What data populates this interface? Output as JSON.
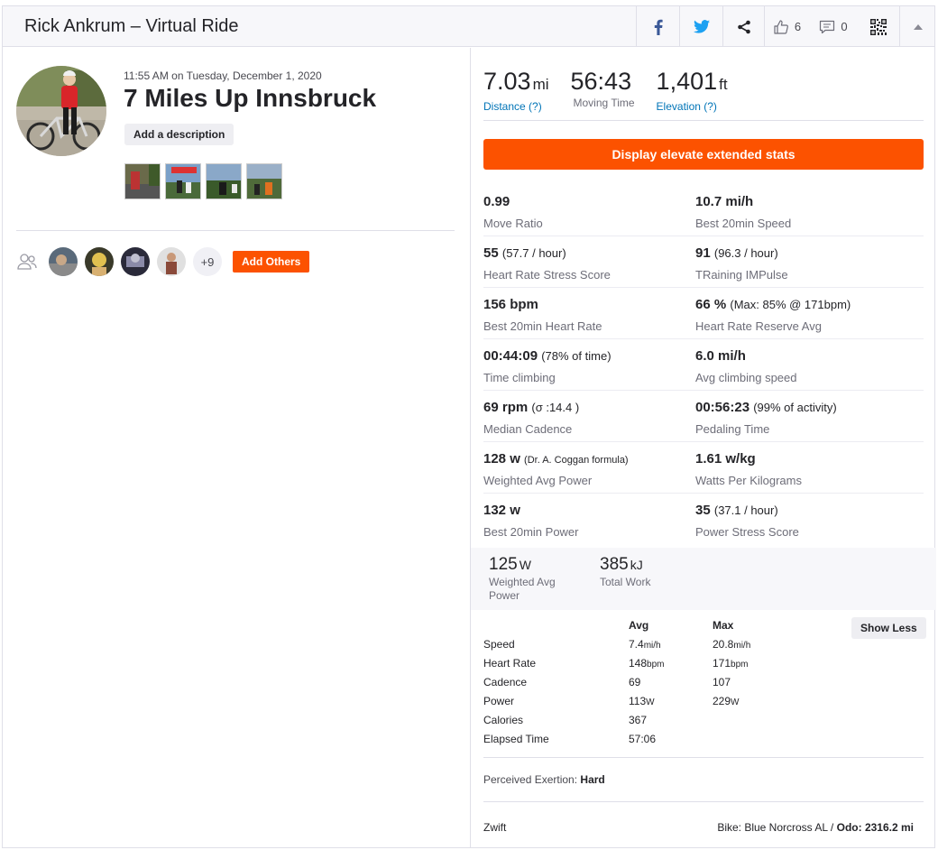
{
  "header": {
    "title": "Rick Ankrum – Virtual Ride",
    "kudos_count": "6",
    "comment_count": "0"
  },
  "activity": {
    "datetime": "11:55 AM on Tuesday, December 1, 2020",
    "name": "7 Miles Up Innsbruck",
    "add_description": "Add a description"
  },
  "group": {
    "more_count": "+9",
    "add_others": "Add Others"
  },
  "inline_stats": [
    {
      "value": "7.03",
      "unit": "mi",
      "label": "Distance (?)"
    },
    {
      "value": "56:43",
      "unit": "",
      "label": "Moving Time"
    },
    {
      "value": "1,401",
      "unit": "ft",
      "label": "Elevation (?)"
    }
  ],
  "elevate_button": "Display elevate extended stats",
  "extended": {
    "rows": [
      [
        {
          "value": "0.99",
          "sub": "",
          "label": "Move Ratio"
        },
        {
          "value": "10.7 mi/h",
          "sub": "",
          "label": "Best 20min Speed"
        }
      ],
      [
        {
          "value": "55",
          "sub": "(57.7 / hour)",
          "label": "Heart Rate Stress Score"
        },
        {
          "value": "91",
          "sub": "(96.3 / hour)",
          "label": "TRaining IMPulse"
        }
      ],
      [
        {
          "value": "156 bpm",
          "sub": "",
          "label": "Best 20min Heart Rate"
        },
        {
          "value": "66 %",
          "sub": "(Max: 85% @ 171bpm)",
          "label": "Heart Rate Reserve Avg"
        }
      ],
      [
        {
          "value": "00:44:09",
          "sub": "(78% of time)",
          "label": "Time climbing"
        },
        {
          "value": "6.0 mi/h",
          "sub": "",
          "label": "Avg climbing speed"
        }
      ],
      [
        {
          "value": "69 rpm",
          "sub": "(σ :14.4 )",
          "label": "Median Cadence"
        },
        {
          "value": "00:56:23",
          "sub": "(99% of activity)",
          "label": "Pedaling Time"
        }
      ],
      [
        {
          "value": "128 w",
          "sub": "(Dr. A. Coggan formula)",
          "label": "Weighted Avg Power"
        },
        {
          "value": "1.61 w/kg",
          "sub": "",
          "label": "Watts Per Kilograms"
        }
      ],
      [
        {
          "value": "132 w",
          "sub": "",
          "label": "Best 20min Power"
        },
        {
          "value": "35",
          "sub": "(37.1 / hour)",
          "label": "Power Stress Score"
        }
      ]
    ]
  },
  "power": {
    "weighted_value": "125",
    "weighted_unit": "W",
    "weighted_label_1": "Weighted Avg",
    "weighted_label_2": "Power",
    "work_value": "385",
    "work_unit": "kJ",
    "work_label": "Total Work"
  },
  "more_stats": {
    "avg_header": "Avg",
    "max_header": "Max",
    "show_less": "Show Less",
    "rows": [
      {
        "label": "Speed",
        "avg": "7.4",
        "avg_unit": "mi/h",
        "max": "20.8",
        "max_unit": "mi/h"
      },
      {
        "label": "Heart Rate",
        "avg": "148",
        "avg_unit": "bpm",
        "max": "171",
        "max_unit": "bpm"
      },
      {
        "label": "Cadence",
        "avg": "69",
        "avg_unit": "",
        "max": "107",
        "max_unit": ""
      },
      {
        "label": "Power",
        "avg": "113",
        "avg_unit": "W",
        "max": "229",
        "max_unit": "W"
      },
      {
        "label": "Calories",
        "avg": "367",
        "avg_unit": "",
        "max": "",
        "max_unit": ""
      },
      {
        "label": "Elapsed Time",
        "avg": "57:06",
        "avg_unit": "",
        "max": "",
        "max_unit": ""
      }
    ]
  },
  "exertion": {
    "label": "Perceived Exertion:",
    "value": "Hard"
  },
  "device": "Zwift",
  "bike": {
    "label": "Bike: Blue Norcross AL /",
    "odo_label": "Odo:",
    "odo_value": "2316.2 mi"
  },
  "colors": {
    "accent": "#fc5200",
    "link": "#0074b7",
    "facebook": "#3b5998",
    "twitter": "#1da1f2"
  }
}
